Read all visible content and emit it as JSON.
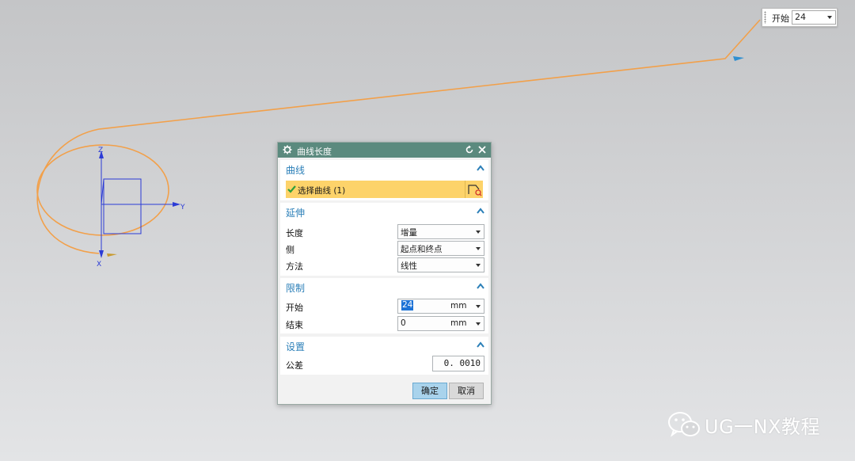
{
  "onscreen_input": {
    "label": "开始",
    "value": "24"
  },
  "axes": {
    "z": "Z",
    "y": "Y",
    "x": "X"
  },
  "dialog": {
    "title": "曲线长度",
    "groups": {
      "curve": {
        "title": "曲线",
        "select_label": "选择曲线 (1)"
      },
      "extend": {
        "title": "延伸",
        "length_label": "长度",
        "length_value": "增量",
        "side_label": "侧",
        "side_value": "起点和终点",
        "method_label": "方法",
        "method_value": "线性"
      },
      "limits": {
        "title": "限制",
        "start_label": "开始",
        "start_value": "24",
        "start_unit": "mm",
        "end_label": "结束",
        "end_value": "0",
        "end_unit": "mm"
      },
      "settings": {
        "title": "设置",
        "tolerance_label": "公差",
        "tolerance_value": "0. 0010"
      }
    },
    "ok_label": "确定",
    "cancel_label": "取消"
  },
  "watermark": "UG一NX教程",
  "colors": {
    "curve": "#f2a04a",
    "axis": "#2b3bd6",
    "title_bar": "#5b8a7e",
    "group_title": "#2b7fb8",
    "selection": "#fdd36a",
    "ok_button": "#a9d3ec"
  }
}
